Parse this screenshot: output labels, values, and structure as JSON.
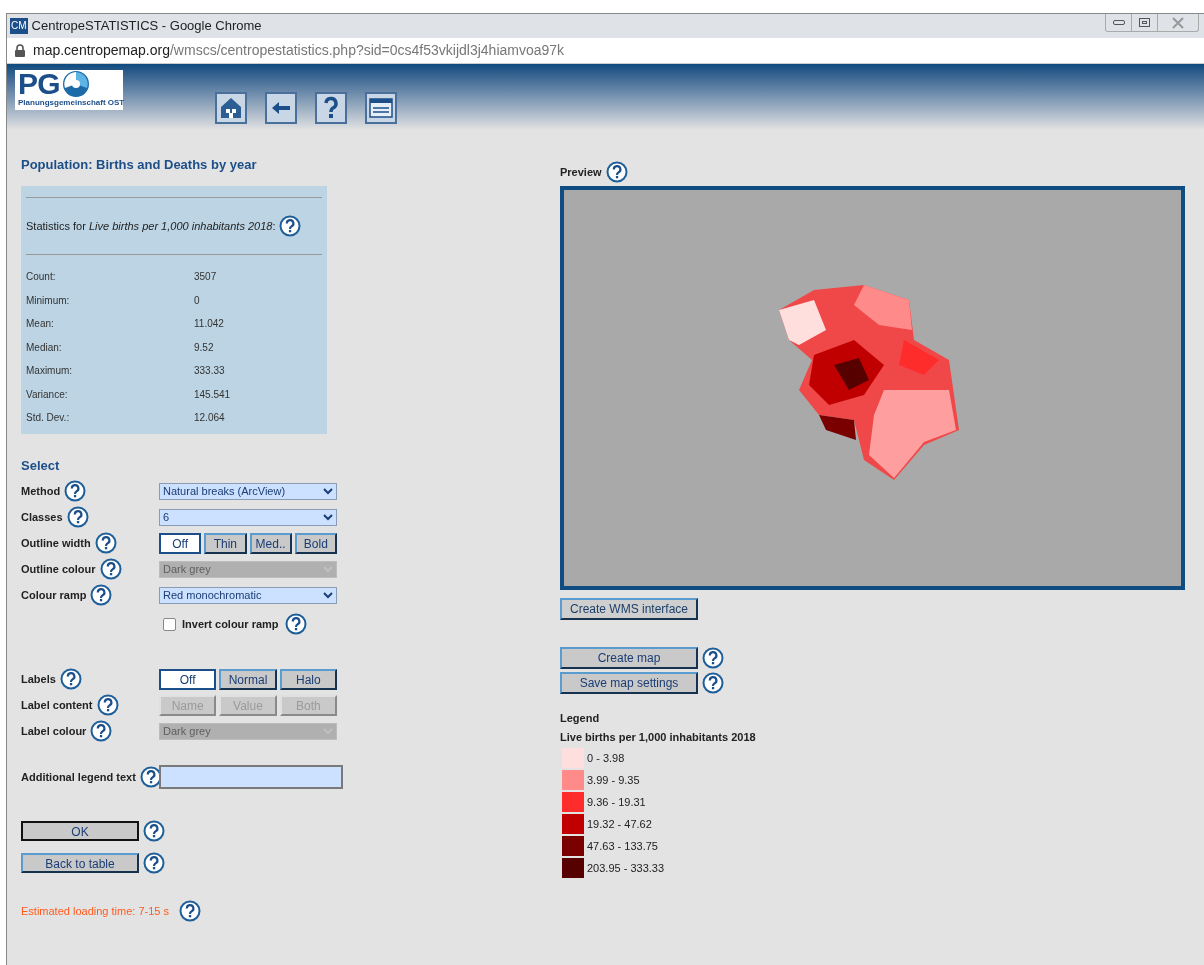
{
  "window": {
    "title": "CentropeSTATISTICS - Google Chrome",
    "app_icon": "CM"
  },
  "address_bar": {
    "domain": "map.centropemap.org",
    "path": "/wmscs/centropestatistics.php?sid=0cs4f53vkijdl3j4hiamvoa97k"
  },
  "logo": {
    "letters": "PG",
    "caption": "Planungsgemeinschaft OST"
  },
  "page_title": "Population: Births and Deaths by year",
  "statistics": {
    "heading": "Statistics for *Live births per 1,000 inhabitants 2018*:",
    "rows": [
      {
        "label": "Count:",
        "value": "3507"
      },
      {
        "label": "Minimum:",
        "value": "0"
      },
      {
        "label": "Mean:",
        "value": "11.042"
      },
      {
        "label": "Median:",
        "value": "9.52"
      },
      {
        "label": "Maximum:",
        "value": "333.33"
      },
      {
        "label": "Variance:",
        "value": "145.541"
      },
      {
        "label": "Std. Dev.:",
        "value": "12.064"
      }
    ]
  },
  "select_heading": "Select",
  "settings": [
    {
      "kind": "select",
      "label": "Method",
      "value": "Natural breaks (ArcView)",
      "disabled": false
    },
    {
      "kind": "select",
      "label": "Classes",
      "value": "6",
      "disabled": false
    },
    {
      "kind": "buttons",
      "label": "Outline width",
      "disabled": false,
      "options": [
        {
          "label": "Off",
          "selected": true
        },
        {
          "label": "Thin",
          "selected": false
        },
        {
          "label": "Med..",
          "selected": false
        },
        {
          "label": "Bold",
          "selected": false
        }
      ]
    },
    {
      "kind": "select",
      "label": "Outline colour",
      "value": "Dark grey",
      "disabled": true
    },
    {
      "kind": "select",
      "label": "Colour ramp",
      "value": "Red monochromatic",
      "disabled": false
    },
    {
      "kind": "checkbox",
      "label": "Invert colour ramp",
      "checked": false
    },
    {
      "kind": "spacer"
    },
    {
      "kind": "buttons",
      "label": "Labels",
      "disabled": false,
      "options": [
        {
          "label": "Off",
          "selected": true
        },
        {
          "label": "Normal",
          "selected": false
        },
        {
          "label": "Halo",
          "selected": false
        }
      ]
    },
    {
      "kind": "buttons",
      "label": "Label content",
      "disabled": true,
      "options": [
        {
          "label": "Name",
          "selected": false
        },
        {
          "label": "Value",
          "selected": false
        },
        {
          "label": "Both",
          "selected": false
        }
      ]
    },
    {
      "kind": "select",
      "label": "Label colour",
      "value": "Dark grey",
      "disabled": true
    },
    {
      "kind": "input",
      "label": "Additional legend text"
    }
  ],
  "actions": [
    {
      "label": "OK",
      "focused": true
    },
    {
      "label": "Back to table",
      "focused": false
    }
  ],
  "loading_note": "Estimated loading time: 7-15 s",
  "preview": {
    "label": "Preview"
  },
  "wms_button": "Create WMS interface",
  "map_buttons": [
    "Create map",
    "Save map settings"
  ],
  "legend": {
    "heading": "Legend",
    "title": "Live births per 1,000 inhabitants 2018",
    "items": [
      {
        "label": "0 - 3.98",
        "color": "#ffdede"
      },
      {
        "label": "3.99 - 9.35",
        "color": "#ff8a8a"
      },
      {
        "label": "9.36 - 19.31",
        "color": "#ff2c2c"
      },
      {
        "label": "19.32 - 47.62",
        "color": "#c00000"
      },
      {
        "label": "47.63 - 133.75",
        "color": "#7a0000"
      },
      {
        "label": "203.95 - 333.33",
        "color": "#560000"
      }
    ]
  }
}
